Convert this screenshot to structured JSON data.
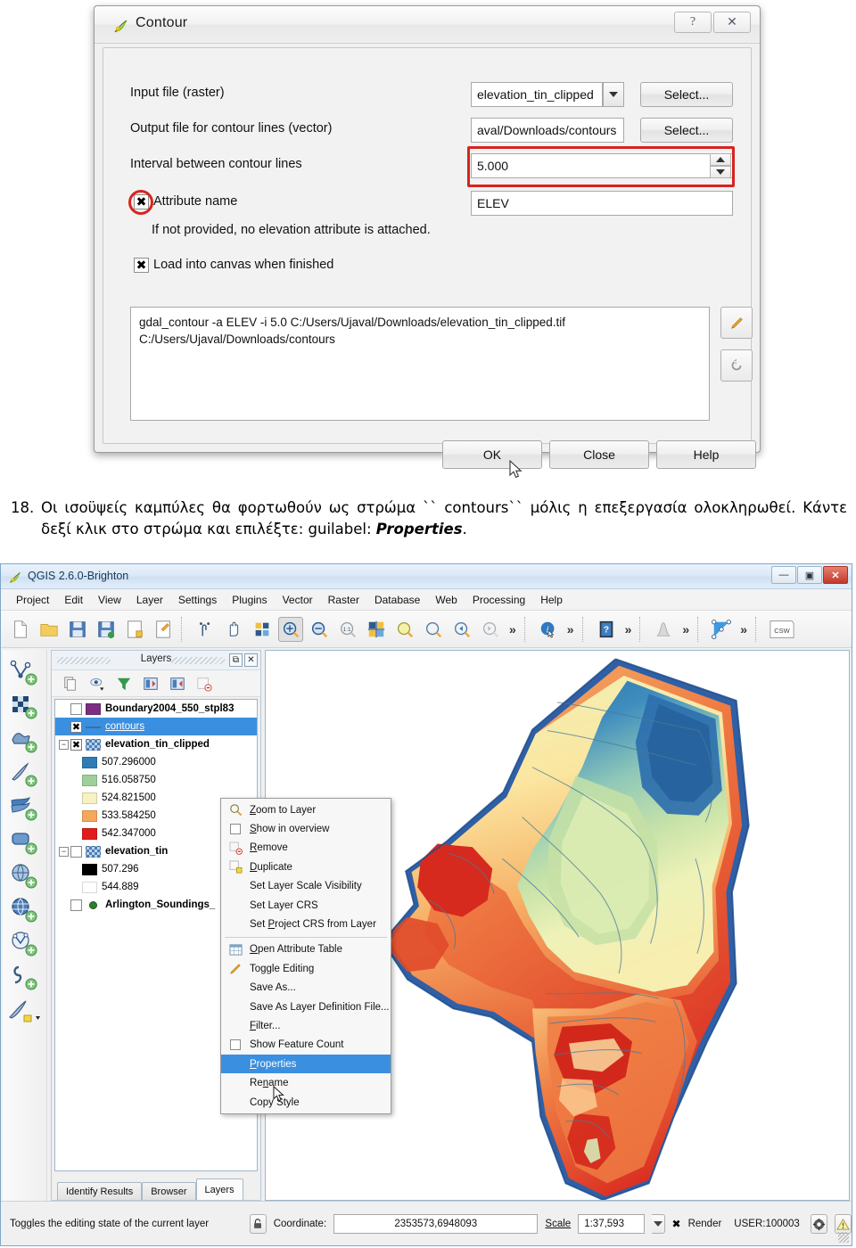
{
  "contour_dialog": {
    "title": "Contour",
    "app_icon": "qgis-leaf-icon",
    "help_btn": "?",
    "close_btn": "✕",
    "rows": [
      {
        "label": "Input file (raster)",
        "value": "elevation_tin_clipped",
        "button": "Select..."
      },
      {
        "label": "Output file for contour lines (vector)",
        "value": "aval/Downloads/contours",
        "button": "Select..."
      },
      {
        "label": "Interval between contour lines",
        "value": "5.000"
      }
    ],
    "attribute_name_label": "Attribute name",
    "attribute_name_value": "ELEV",
    "attribute_hint": "If not provided, no elevation attribute is attached.",
    "load_into_canvas_label": "Load into canvas when finished",
    "checkbox_mark": "✖",
    "command_line1": "gdal_contour -a ELEV -i 5.0 C:/Users/Ujaval/Downloads/elevation_tin_clipped.tif",
    "command_line2": "C:/Users/Ujaval/Downloads/contours",
    "buttons": {
      "ok": "OK",
      "close": "Close",
      "help": "Help"
    },
    "highlight_color": "#d8241f"
  },
  "caption": {
    "number": "18.",
    "line1": "Οι ισοϋψείς καμπύλες θα φορτωθούν ως στρώμα `` contours`` μόλις η",
    "line2": "επεξεργασία ολοκληρωθεί. Κάντε δεξί κλικ στο στρώμα και επιλέξτε: guilabel:",
    "bold_word": "Properties",
    "end": "."
  },
  "qgis": {
    "title": "QGIS 2.6.0-Brighton",
    "window_buttons": {
      "minimize": "—",
      "maximize": "▣",
      "close": "✕"
    },
    "menus": [
      "Project",
      "Edit",
      "View",
      "Layer",
      "Settings",
      "Plugins",
      "Vector",
      "Raster",
      "Database",
      "Web",
      "Processing",
      "Help"
    ],
    "toolbar_icons": [
      "new-project-icon",
      "open-project-icon",
      "save-project-icon",
      "save-project-as-icon",
      "new-print-composer-icon",
      "composer-manager-icon",
      "touch-zoom-icon",
      "pan-map-icon",
      "pan-to-selection-icon",
      "zoom-in-icon",
      "zoom-out-icon",
      "zoom-native-icon",
      "zoom-full-icon",
      "zoom-to-selection-icon",
      "zoom-to-layer-icon",
      "zoom-last-icon",
      "zoom-next-icon",
      "identify-features-icon",
      "help-contents-icon",
      "statistics-icon",
      "vertex-tool-icon",
      "csw-icon"
    ],
    "toolbar_chevron": "»",
    "csw_label": "CSW",
    "left_toolbar_icons": [
      "add-vector-layer-icon",
      "add-raster-layer-icon",
      "add-mesh-layer-icon",
      "add-delimited-text-layer-icon",
      "add-spatialite-layer-icon",
      "add-postgis-layer-icon",
      "add-wms-layer-icon",
      "add-wcs-layer-icon",
      "add-wfs-layer-icon",
      "add-virtual-layer-icon",
      "new-shapefile-layer-icon"
    ],
    "layers_panel": {
      "title": "Layers",
      "float_btn": "⧉",
      "close_btn": "✕",
      "toolbar_icons": [
        "add-group-icon",
        "manage-visibility-icon",
        "filter-legend-icon",
        "expand-all-icon",
        "collapse-all-icon",
        "remove-layer-icon"
      ],
      "tree": [
        {
          "name": "Boundary2004_550_stpl83",
          "checked": false,
          "bold": true,
          "swatch": "purple",
          "indent": 1,
          "expandable": false
        },
        {
          "name": "contours",
          "checked": true,
          "bold": false,
          "swatch": "line",
          "indent": 2,
          "selected": true,
          "expandable": false
        },
        {
          "name": "elevation_tin_clipped",
          "checked": true,
          "bold": true,
          "swatch": "checker",
          "indent": 0,
          "expandable": true
        },
        {
          "name": "507.296000",
          "swatch": "#2d7cb5",
          "indent": 3,
          "child": true
        },
        {
          "name": "516.058750",
          "swatch": "#9ecf9a",
          "indent": 3,
          "child": true
        },
        {
          "name": "524.821500",
          "swatch": "#f6f2c2",
          "indent": 3,
          "child": true
        },
        {
          "name": "533.584250",
          "swatch": "#f5a85c",
          "indent": 3,
          "child": true
        },
        {
          "name": "542.347000",
          "swatch": "#e31a1c",
          "indent": 3,
          "child": true
        },
        {
          "name": "elevation_tin",
          "checked": false,
          "bold": true,
          "swatch": "checker",
          "indent": 0,
          "expandable": true
        },
        {
          "name": "507.296",
          "swatch": "#000000",
          "indent": 3,
          "child": true
        },
        {
          "name": "544.889",
          "swatch": "#ffffff",
          "indent": 3,
          "child": true
        },
        {
          "name": "Arlington_Soundings_",
          "checked": false,
          "bold": true,
          "swatch": "dot",
          "indent": 1,
          "expandable": false
        }
      ],
      "tabs": [
        {
          "label": "Identify Results",
          "active": false
        },
        {
          "label": "Browser",
          "active": false
        },
        {
          "label": "Layers",
          "active": true
        }
      ]
    },
    "context_menu": {
      "items": [
        {
          "label": "Zoom to Layer",
          "icon": "zoom-to-layer-icon",
          "accel": "Z"
        },
        {
          "label": "Show in overview",
          "icon": "checkbox-icon",
          "accel": "S"
        },
        {
          "label": "Remove",
          "icon": "remove-layer-icon",
          "accel": "R"
        },
        {
          "label": "Duplicate",
          "icon": "duplicate-layer-icon",
          "accel": "D"
        },
        {
          "label": "Set Layer Scale Visibility",
          "icon": "",
          "accel": ""
        },
        {
          "label": "Set Layer CRS",
          "icon": "",
          "accel": ""
        },
        {
          "label": "Set Project CRS from Layer",
          "icon": "",
          "accel": "P"
        },
        {
          "separator": true
        },
        {
          "label": "Open Attribute Table",
          "icon": "attribute-table-icon",
          "accel": "O"
        },
        {
          "label": "Toggle Editing",
          "icon": "pencil-icon",
          "accel": ""
        },
        {
          "label": "Save As...",
          "icon": "",
          "accel": ""
        },
        {
          "label": "Save As Layer Definition File...",
          "icon": "",
          "accel": ""
        },
        {
          "label": "Filter...",
          "icon": "",
          "accel": "F"
        },
        {
          "label": "Show Feature Count",
          "icon": "checkbox-icon",
          "accel": ""
        },
        {
          "label": "Properties",
          "icon": "",
          "accel": "P",
          "highlighted": true
        },
        {
          "label": "Rename",
          "icon": "",
          "accel": "n"
        },
        {
          "label": "Copy Style",
          "icon": "",
          "accel": ""
        }
      ]
    },
    "status_bar": {
      "hint": "Toggles the editing state of the current layer",
      "lock_icon": "lock-coordinate-icon",
      "coordinate_label": "Coordinate:",
      "coordinate_value": "2353573,6948093",
      "scale_label": "Scale",
      "scale_value": "1:37,593",
      "render_label": "Render",
      "render_checked": true,
      "crs_label": "USER:100003",
      "crs_icon": "crs-globe-icon",
      "message_icon": "warning-icon"
    }
  }
}
